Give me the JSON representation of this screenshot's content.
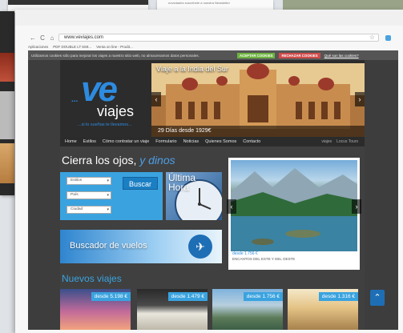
{
  "background": {
    "note_text": "novedades suscríbete a nuestra Newsletter"
  },
  "browser": {
    "url": "www.veviajes.com",
    "bookmarks": [
      "Aplicaciones",
      "PDF DOUBLE LT 6S9...",
      "Venta on line - Prod3..."
    ]
  },
  "cookie_bar": {
    "text": "Utilizamos cookies sólo para mejorar los viajes a nuestro sitio web, no almacenamos datos personales.",
    "accept_label": "ACEPTAR COOKIES",
    "reject_label": "RECHAZAR COOKIES",
    "info_link": "Qué son las cookies?"
  },
  "logo": {
    "ve": "ve",
    "dots": "...",
    "viajes": "viajes",
    "tagline": "...si lo sueñas te llevamos..."
  },
  "slider": {
    "title": "Viaje a la India del Sur",
    "caption": "29 Días desde 1929€"
  },
  "menu": {
    "items": [
      "Home",
      "Estilos",
      "Cómo contratar un viaje",
      "Formulario",
      "Noticias",
      "Quienes Somos",
      "Contacto"
    ],
    "partner_logos": [
      "viajes",
      "Locus Tours"
    ]
  },
  "tagline": {
    "main": "Cierra los ojos,",
    "accent": "y dinos"
  },
  "search": {
    "select_estilos": "Estilos",
    "select_pais": "País",
    "select_ciudad": "Ciudad",
    "button_label": "Buscar"
  },
  "ultima_hora": {
    "line1": "Última",
    "line2": "Hora"
  },
  "gallery": {
    "price": "desde 1.756 €",
    "title": "ENCANTOS DEL ESTE Y DEL OESTE"
  },
  "buscador": {
    "label": "Buscador de vuelos"
  },
  "nuevos": {
    "heading": "Nuevos viajes",
    "cards": [
      {
        "price": "desde 5.198 €"
      },
      {
        "price": "desde 1.479 €"
      },
      {
        "price": "desde 1.756 €"
      },
      {
        "price": "desde 1.316 €"
      }
    ]
  },
  "colors": {
    "brand_blue": "#2d8be0",
    "accept_green": "#6db33f",
    "reject_red": "#d14b4b",
    "page_bg": "#3d3d3d"
  }
}
